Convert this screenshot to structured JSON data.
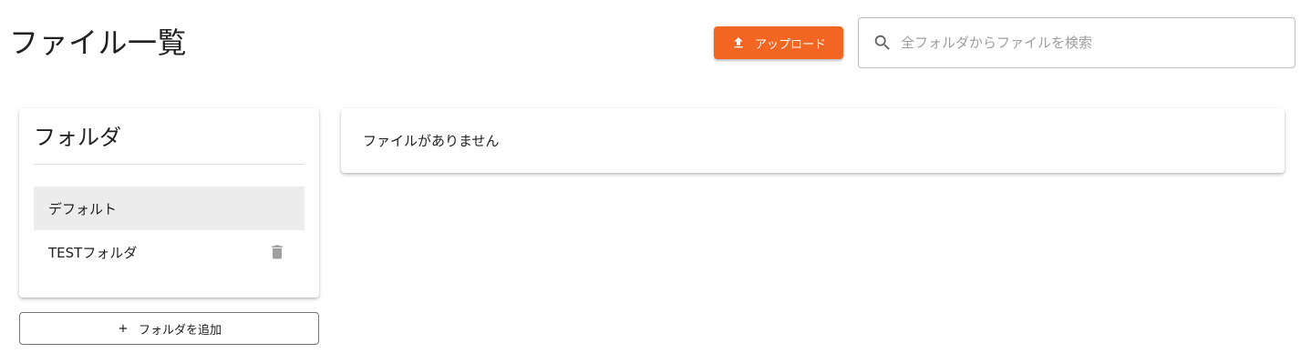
{
  "header": {
    "title": "ファイル一覧",
    "upload_label": "アップロード",
    "search_placeholder": "全フォルダからファイルを検索",
    "search_value": ""
  },
  "folders": {
    "title": "フォルダ",
    "items": [
      {
        "label": "デフォルト",
        "selected": true,
        "deletable": false
      },
      {
        "label": "TESTフォルダ",
        "selected": false,
        "deletable": true
      }
    ],
    "add_label": "フォルダを追加"
  },
  "files": {
    "empty_message": "ファイルがありません"
  },
  "icons": {
    "upload": "upload-icon",
    "search": "search-icon",
    "delete": "trash-icon",
    "add": "plus-icon"
  },
  "colors": {
    "accent": "#f26522",
    "selected_bg": "#ececec",
    "icon_gray": "#9e9e9e"
  }
}
